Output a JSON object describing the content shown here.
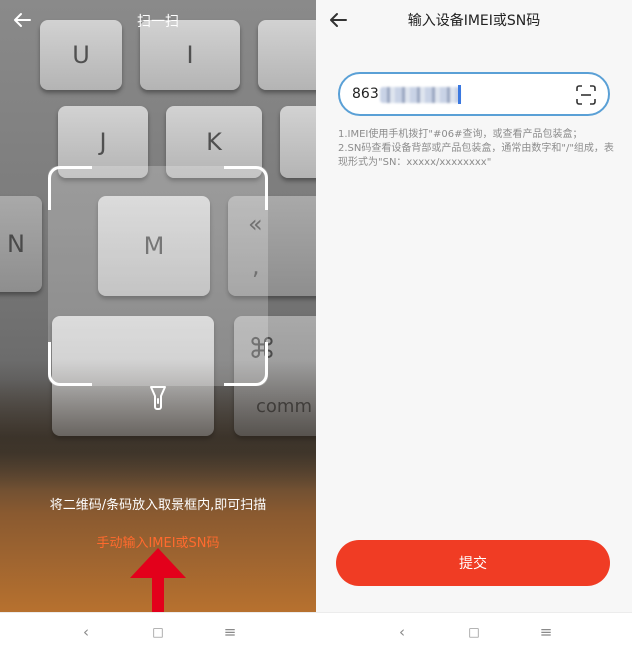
{
  "scanner": {
    "title": "扫一扫",
    "hint": "将二维码/条码放入取景框内,即可扫描",
    "manual_link": "手动输入IMEI或SN码",
    "keys": [
      "U",
      "I",
      "J",
      "K",
      "N",
      "M",
      "«",
      ",",
      "⌘",
      "comm"
    ]
  },
  "input_page": {
    "title": "输入设备IMEI或SN码",
    "imei_value": "863",
    "tips": [
      "1.IMEI使用手机拨打\"#06#查询，或查看产品包装盒；",
      "2.SN码查看设备背部或产品包装盒，通常由数字和\"/\"组成，表现形式为\"SN：xxxxx/xxxxxxxx\""
    ],
    "submit_label": "提交"
  },
  "navbar": {
    "left": {
      "back": "‹",
      "home": "□",
      "menu": "≡"
    },
    "right": {
      "back": "‹",
      "home": "□",
      "menu": "≡"
    }
  },
  "colors": {
    "accent": "#f03c24",
    "link": "#ff6a2e",
    "input_border": "#5aa0d6"
  }
}
